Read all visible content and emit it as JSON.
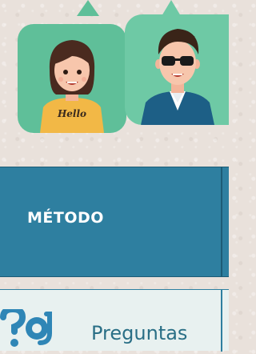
{
  "hero": {
    "avatars": [
      {
        "name": "girl",
        "shirt_text": "Hello",
        "bubble_color": "#5fbf99"
      },
      {
        "name": "boy",
        "bubble_color": "#6ec9a5"
      }
    ]
  },
  "method": {
    "label": "MÉTODO",
    "color": "#2e7fa0"
  },
  "questions": {
    "label": "Preguntas",
    "icon": "question-chat-icon"
  }
}
